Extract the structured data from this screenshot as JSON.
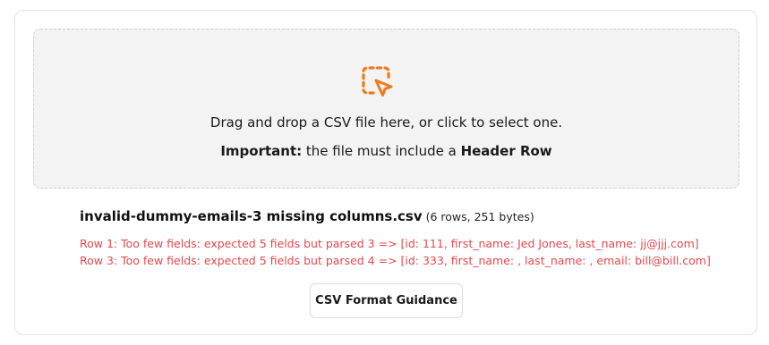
{
  "dropzone": {
    "icon": "dashed-square-cursor-icon",
    "icon_color": "#f07a20",
    "instruction": "Drag and drop a CSV file here, or click to select one.",
    "important_label": "Important:",
    "important_text": " the file must include a ",
    "important_emphasis": "Header Row"
  },
  "file": {
    "name": "invalid-dummy-emails-3 missing columns.csv",
    "meta": " (6 rows, 251 bytes)"
  },
  "errors": [
    "Row 1: Too few fields: expected 5 fields but parsed 3 => [id: 111, first_name: Jed Jones, last_name: jj@jjj.com]",
    "Row 3: Too few fields: expected 5 fields but parsed 4 => [id: 333, first_name: , last_name: , email: bill@bill.com]"
  ],
  "error_color": "#e5484d",
  "actions": {
    "guidance_label": "CSV Format Guidance"
  }
}
